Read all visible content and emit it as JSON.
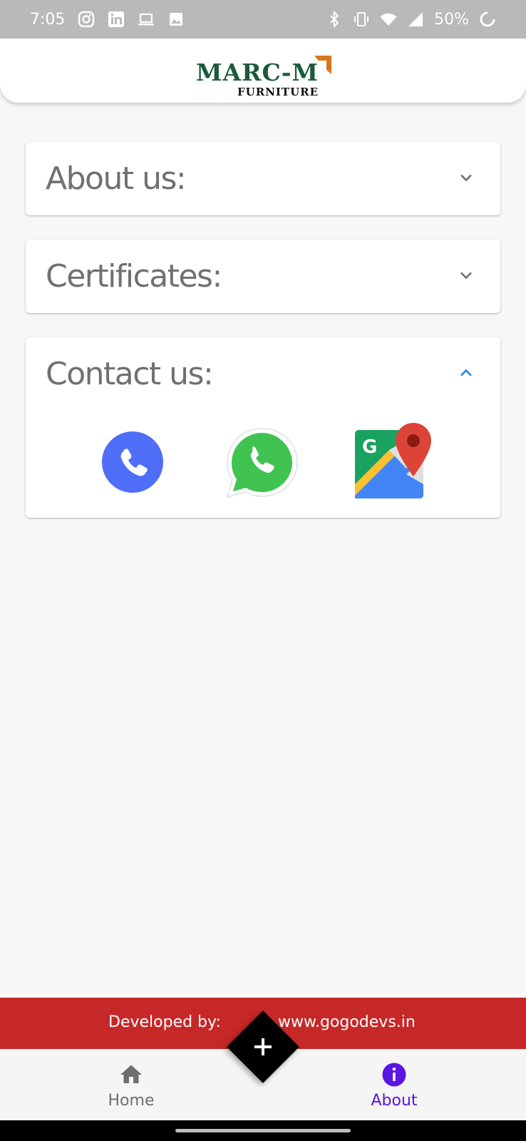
{
  "status_bar": {
    "time": "7:05",
    "battery": "50%",
    "notification_icons": [
      "instagram-icon",
      "linkedin-icon",
      "laptop-icon",
      "image-icon"
    ],
    "system_icons": [
      "bluetooth-icon",
      "vibrate-icon",
      "wifi-icon",
      "signal-icon",
      "battery-saver-icon"
    ]
  },
  "header": {
    "logo_main": "MARC-M",
    "logo_sub": "FURNITURE",
    "brand_green": "#1c5a3a",
    "brand_orange": "#d9771e"
  },
  "sections": [
    {
      "title": "About us:",
      "expanded": false
    },
    {
      "title": "Certificates:",
      "expanded": false
    },
    {
      "title": "Contact us:",
      "expanded": true
    }
  ],
  "contact_actions": [
    "phone-icon",
    "whatsapp-icon",
    "google-maps-icon"
  ],
  "footer": {
    "developed_by": "Developed by:",
    "url": "www.gogodevs.in",
    "color": "#c62828"
  },
  "bottom_nav": {
    "items": [
      {
        "label": "Home",
        "icon": "home-icon",
        "active": false
      },
      {
        "label": "About",
        "icon": "info-icon",
        "active": true
      }
    ],
    "fab_icon": "plus-icon",
    "active_color": "#5a16e0"
  }
}
